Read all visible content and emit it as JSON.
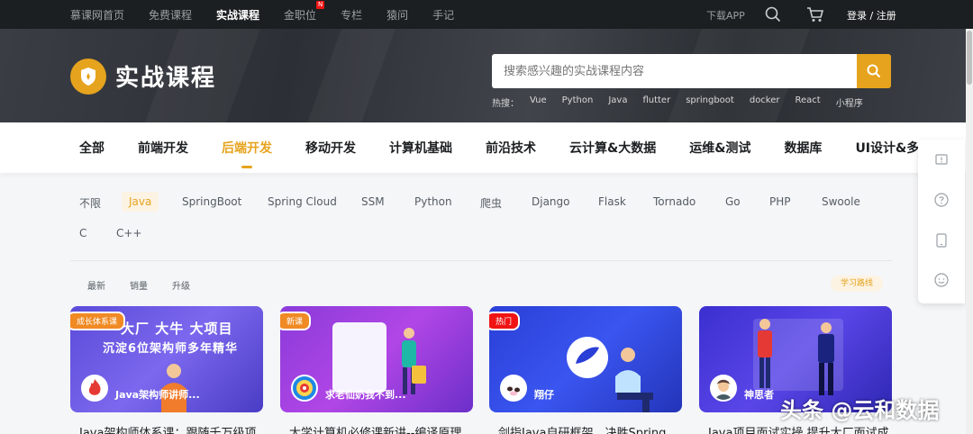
{
  "topnav": {
    "links": [
      "慕课网首页",
      "免费课程",
      "实战课程",
      "金职位",
      "专栏",
      "猿问",
      "手记"
    ],
    "active_index": 2,
    "new_badge": "N",
    "download": "下载APP",
    "login": "登录 / 注册"
  },
  "banner": {
    "title": "实战课程",
    "search_placeholder": "搜索感兴趣的实战课程内容",
    "hot_label": "热搜：",
    "hot_words": [
      "Vue",
      "Python",
      "Java",
      "flutter",
      "springboot",
      "docker",
      "React",
      "小程序"
    ]
  },
  "categories": [
    "全部",
    "前端开发",
    "后端开发",
    "移动开发",
    "计算机基础",
    "前沿技术",
    "云计算&大数据",
    "运维&测试",
    "数据库",
    "UI设计&多媒体"
  ],
  "active_category": 2,
  "tags": [
    "不限",
    "Java",
    "SpringBoot",
    "Spring Cloud",
    "SSM",
    "Python",
    "爬虫",
    "Django",
    "Flask",
    "Tornado",
    "Go",
    "PHP",
    "Swoole",
    "C",
    "C++"
  ],
  "active_tag": 1,
  "sort": [
    "最新",
    "销量",
    "升级"
  ],
  "route_label": "学习路线",
  "cards": [
    {
      "badge": "成长体系课",
      "teacher": "Java架构师讲师...",
      "title": "Java架构师体系课：跟随千万级项",
      "cover_text_1": "大厂 大牛 大项目",
      "cover_text_2": "沉淀6位架构师多年精华"
    },
    {
      "badge": "新课",
      "teacher": "求老仙奶我不到...",
      "title": "大学计算机必修课新讲--编译原理"
    },
    {
      "badge": "热门",
      "teacher": "翔仔",
      "title": "剑指Java自研框架，决胜Spring"
    },
    {
      "badge": "",
      "teacher": "神思者",
      "title": "Java项目面试实操 提升大厂面试成"
    }
  ],
  "watermark": "头条 @云和数据",
  "colors": {
    "accent": "#e6a31d",
    "topnav_bg": "#1c1f21",
    "badge_red": "#f01414"
  }
}
